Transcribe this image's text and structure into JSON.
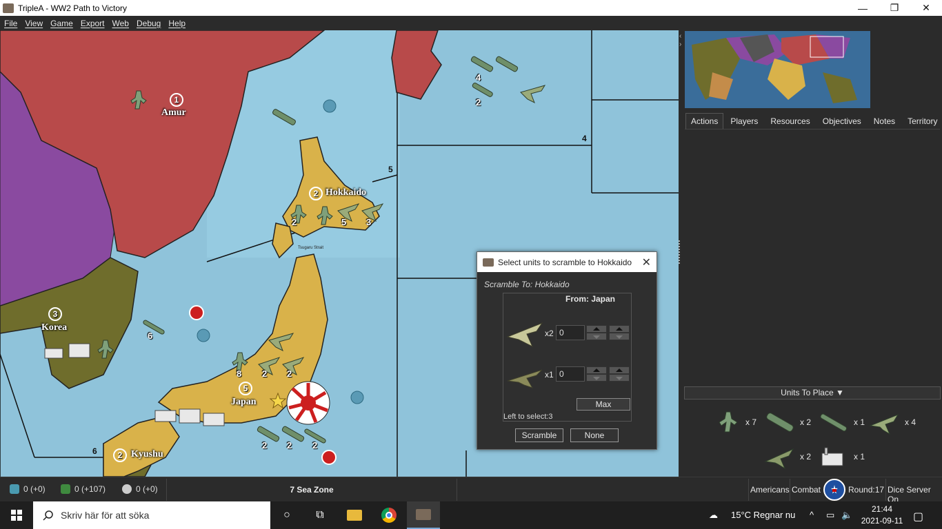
{
  "window": {
    "title": "TripleA - WW2 Path to Victory"
  },
  "menu": [
    "File",
    "View",
    "Game",
    "Export",
    "Web",
    "Debug",
    "Help"
  ],
  "map": {
    "territories": [
      {
        "name": "Amur",
        "ipc": "1"
      },
      {
        "name": "Hokkaido",
        "ipc": "2"
      },
      {
        "name": "Korea",
        "ipc": "3"
      },
      {
        "name": "Japan",
        "ipc": "5"
      },
      {
        "name": "Kyushu",
        "ipc": "2"
      }
    ],
    "strait_label": "Tsugaru Strait",
    "sea_zone_numbers": [
      "4",
      "5",
      "6"
    ],
    "unit_counts": {
      "north_ships_top": "4",
      "north_ships_bottom": "2",
      "hokkaido_a": "2",
      "hokkaido_b": "5",
      "hokkaido_c": "3",
      "korea_sea": "6",
      "japan_a": "8",
      "japan_b": "2",
      "japan_c": "2",
      "south_a": "2",
      "south_b": "2",
      "south_c": "2"
    }
  },
  "right_panel": {
    "tabs": [
      "Actions",
      "Players",
      "Resources",
      "Objectives",
      "Notes",
      "Territory"
    ],
    "active_tab": "Actions",
    "units_to_place_header": "Units To Place ▼",
    "units_to_place": [
      {
        "icon": "infantry-icon",
        "count": "x 7"
      },
      {
        "icon": "transport-ship-icon",
        "count": "x 2"
      },
      {
        "icon": "submarine-icon",
        "count": "x 1"
      },
      {
        "icon": "fighter-plane-icon",
        "count": "x 4"
      },
      {
        "icon": "bomber-plane-icon",
        "count": "x 2"
      },
      {
        "icon": "factory-icon",
        "count": "x 1"
      }
    ]
  },
  "dialog": {
    "title": "Select units to scramble to Hokkaido",
    "scramble_to": "Scramble To: Hokkaido",
    "from": "From: Japan",
    "rows": [
      {
        "mult": "x2",
        "value": "0"
      },
      {
        "mult": "x1",
        "value": "0"
      }
    ],
    "max_label": "Max",
    "left_to_select": "Left to select:3",
    "scramble_label": "Scramble",
    "none_label": "None"
  },
  "status": {
    "tech": "0 (+0)",
    "money": "0 (+107)",
    "skulls": "0 (+0)",
    "territory": "7 Sea Zone",
    "player": "Americans",
    "phase": "Combat",
    "round": "Round:17",
    "dice": "Dice Server On"
  },
  "taskbar": {
    "search_placeholder": "Skriv här för att söka",
    "weather": "15°C  Regnar nu",
    "time": "21:44",
    "date": "2021-09-11"
  },
  "colors": {
    "soviet_red": "#b84a4a",
    "japan_tan": "#d9b24a",
    "china_olive": "#6f6d2c",
    "purple": "#8a4aa0",
    "sea": "#8fc3da"
  }
}
